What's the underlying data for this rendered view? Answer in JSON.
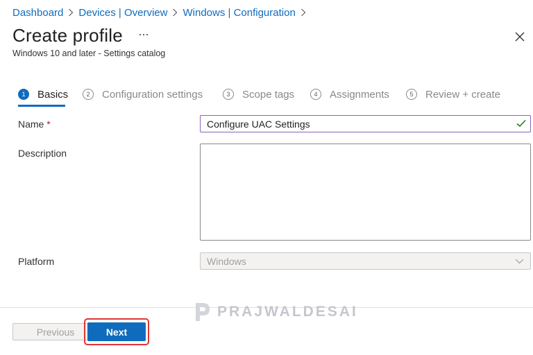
{
  "breadcrumb": [
    "Dashboard",
    "Devices | Overview",
    "Windows | Configuration"
  ],
  "page": {
    "title": "Create profile",
    "subtitle": "Windows 10 and later - Settings catalog"
  },
  "steps": [
    {
      "number": "1",
      "label": "Basics"
    },
    {
      "number": "2",
      "label": "Configuration settings"
    },
    {
      "number": "3",
      "label": "Scope tags"
    },
    {
      "number": "4",
      "label": "Assignments"
    },
    {
      "number": "5",
      "label": "Review + create"
    }
  ],
  "active_step": "1",
  "form": {
    "name_label": "Name",
    "required_marker": "*",
    "name_value": "Configure UAC Settings",
    "description_label": "Description",
    "description_value": "",
    "platform_label": "Platform",
    "platform_value": "Windows"
  },
  "footer": {
    "previous_label": "Previous",
    "next_label": "Next"
  },
  "watermark": "PRAJWALDESAI",
  "colors": {
    "accent": "#0f6cbd",
    "name_border": "#8764b8",
    "valid_check": "#107c10",
    "required": "#a4262c",
    "highlight": "#e03535"
  }
}
